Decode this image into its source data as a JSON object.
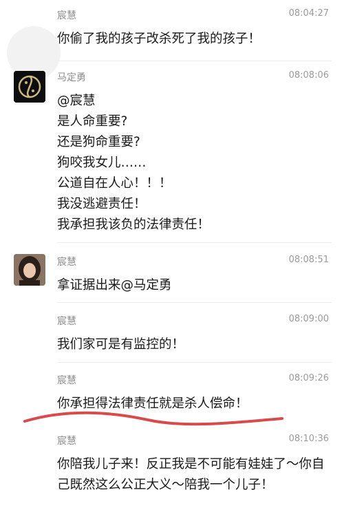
{
  "messages": [
    {
      "sender": "宸慧",
      "time": "08:04:27",
      "lines": [
        "你偷了我的孩子改杀死了我的孩子！"
      ]
    },
    {
      "sender": "马定勇",
      "time": "08:08:06",
      "avatar_icon": "yin-yang-fish-icon",
      "lines": [
        "@宸慧",
        "是人命重要?",
        "还是狗命重要?",
        "狗咬我女儿……",
        "公道自在人心！！！",
        "我没逃避责任！",
        "我承担我该负的法律责任！"
      ]
    },
    {
      "sender": "宸慧",
      "time": "08:08:51",
      "avatar_icon": "woman-portrait-avatar",
      "lines": [
        "拿证据出来@马定勇"
      ]
    },
    {
      "sender": "宸慧",
      "time": "08:09:00",
      "lines": [
        "我们家可是有监控的！"
      ]
    },
    {
      "sender": "宸慧",
      "time": "08:09:26",
      "lines": [
        "你承担得法律责任就是杀人偿命！"
      ]
    },
    {
      "sender": "宸慧",
      "time": "08:10:36",
      "lines": [
        "你陪我儿子来！反正我是不可能有娃娃了～你自己既然这么公正大义～陪我一个儿子！"
      ]
    }
  ],
  "colors": {
    "sender": "#8c8c8c",
    "time": "#9a9a9a",
    "text": "#1a1a1a",
    "divider": "#ececec",
    "underline": "#d94a4a"
  }
}
